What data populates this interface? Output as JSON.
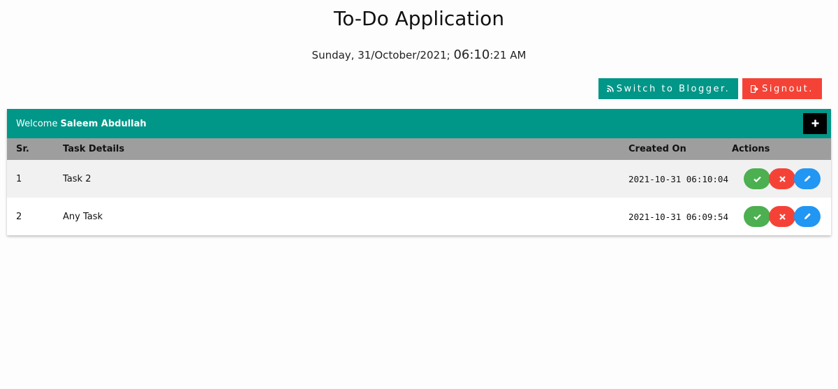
{
  "page": {
    "title": "To-Do Application",
    "date_text": "Sunday, 31/October/2021; ",
    "time_hm": "06:10",
    "time_rest": ":21 AM"
  },
  "toolbar": {
    "switch_label": "Switch to Blogger.",
    "signout_label": "Signout."
  },
  "card": {
    "welcome_prefix": "Welcome",
    "user_name": "Saleem Abdullah"
  },
  "table": {
    "headers": {
      "sr": "Sr.",
      "task": "Task Details",
      "created": "Created On",
      "actions": "Actions"
    },
    "rows": [
      {
        "sr": "1",
        "task": "Task 2",
        "created": "2021-10-31 06:10:04"
      },
      {
        "sr": "2",
        "task": "Any Task",
        "created": "2021-10-31 06:09:54"
      }
    ]
  },
  "icons": {
    "switch": "rss-icon",
    "signout": "sign-out-icon",
    "add": "plus-icon",
    "complete": "check-icon",
    "delete": "close-icon",
    "edit": "pencil-icon"
  },
  "colors": {
    "teal": "#009688",
    "red": "#f44336",
    "green": "#4caf50",
    "blue": "#2196f3",
    "header_gray": "#9e9e9e"
  }
}
